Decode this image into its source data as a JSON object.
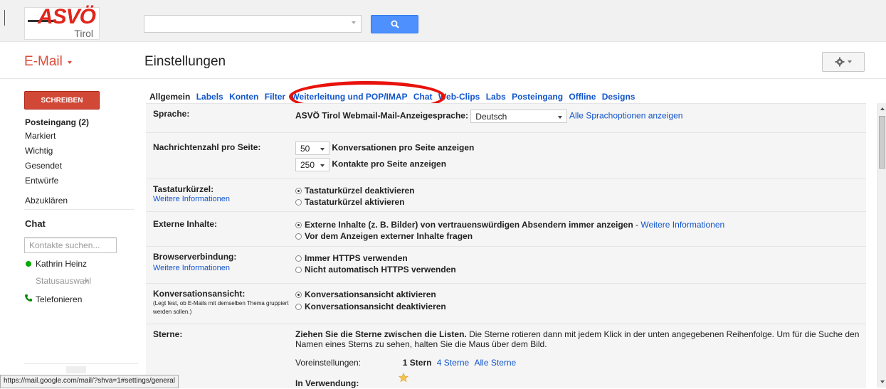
{
  "logo": {
    "brand": "ASVÖ",
    "region": "Tirol"
  },
  "search": {
    "value": "",
    "button_icon": "search-icon"
  },
  "app": {
    "title": "E-Mail",
    "page_title": "Einstellungen"
  },
  "gear": {
    "icon": "gear-icon"
  },
  "nav": {
    "compose": "SCHREIBEN",
    "items": [
      "Posteingang (2)",
      "Markiert",
      "Wichtig",
      "Gesendet",
      "Entwürfe",
      "Abzuklären"
    ]
  },
  "chat": {
    "title": "Chat",
    "search_placeholder": "Kontakte suchen...",
    "contact": "Kathrin Heinz",
    "status": "Statusauswahl",
    "phone": "Telefonieren"
  },
  "statusbar": {
    "url": "https://mail.google.com/mail/?shva=1#settings/general"
  },
  "tabs": [
    "Allgemein",
    "Labels",
    "Konten",
    "Filter",
    "Weiterleitung und POP/IMAP",
    "Chat",
    "Web-Clips",
    "Labs",
    "Posteingang",
    "Offline",
    "Designs"
  ],
  "settings": {
    "sprache": {
      "label": "Sprache:",
      "text": "ASVÖ Tirol Webmail-Mail-Anzeigesprache:",
      "value": "Deutsch",
      "link": "Alle Sprachoptionen anzeigen"
    },
    "nachrichten": {
      "label": "Nachrichtenzahl pro Seite:",
      "conv_value": "50",
      "conv_text": "Konversationen pro Seite anzeigen",
      "contacts_value": "250",
      "contacts_text": "Kontakte pro Seite anzeigen"
    },
    "tastatur": {
      "label": "Tastaturkürzel:",
      "sub": "Weitere Informationen",
      "opt1": "Tastaturkürzel deaktivieren",
      "opt2": "Tastaturkürzel aktivieren"
    },
    "extern": {
      "label": "Externe Inhalte:",
      "opt1": "Externe Inhalte (z. B. Bilder) von vertrauenswürdigen Absendern immer anzeigen",
      "opt1_sep": " - ",
      "opt1_link": "Weitere Informationen",
      "opt2": "Vor dem Anzeigen externer Inhalte fragen"
    },
    "browser": {
      "label": "Browserverbindung:",
      "sub": "Weitere Informationen",
      "opt1": "Immer HTTPS verwenden",
      "opt2": "Nicht automatisch HTTPS verwenden"
    },
    "konversation": {
      "label": "Konversationsansicht:",
      "note": "(Legt fest, ob E-Mails mit demselben Thema gruppiert werden sollen.)",
      "opt1": "Konversationsansicht aktivieren",
      "opt2": "Konversationsansicht deaktivieren"
    },
    "sterne": {
      "label": "Sterne:",
      "bold": "Ziehen Sie die Sterne zwischen die Listen.",
      "desc1": " Die Sterne rotieren dann mit jedem Klick in der unten angegebenen Reihenfolge. Um für die Suche den",
      "desc2": "Namen eines Sterns zu sehen, halten Sie die Maus über dem Bild.",
      "preset_label": "Voreinstellungen:",
      "preset1": "1 Stern",
      "preset2": "4 Sterne",
      "preset3": "Alle Sterne",
      "in_use": "In Verwendung:"
    }
  },
  "colors": {
    "accent_red": "#dd4b39",
    "link_blue": "#1155cc",
    "search_blue": "#4d90fe",
    "highlight": "#e8120c"
  }
}
